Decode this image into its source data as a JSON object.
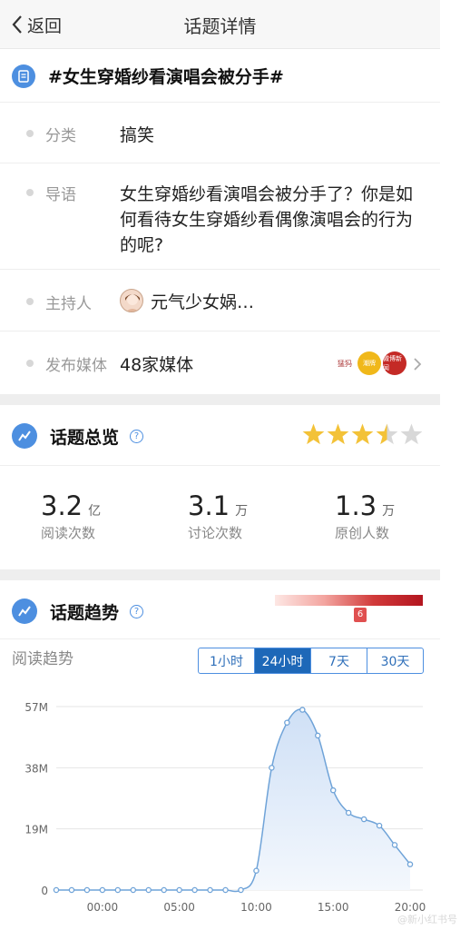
{
  "nav": {
    "back_label": "返回",
    "title": "话题详情"
  },
  "topic": {
    "title": "#女生穿婚纱看演唱会被分手#"
  },
  "info": {
    "category_label": "分类",
    "category_value": "搞笑",
    "intro_label": "导语",
    "intro_value": "女生穿婚纱看演唱会被分手了？你是如何看待女生穿婚纱看偶像演唱会的行为的呢?",
    "host_label": "主持人",
    "host_value": "元气少女娲…",
    "media_label": "发布媒体",
    "media_value": "48家媒体",
    "media_logos": [
      "猛犸",
      "潮牌",
      "微博新闻"
    ]
  },
  "overview": {
    "title": "话题总览",
    "rating": 3.5,
    "stats": [
      {
        "value": "3.2",
        "unit": "亿",
        "label": "阅读次数"
      },
      {
        "value": "3.1",
        "unit": "万",
        "label": "讨论次数"
      },
      {
        "value": "1.3",
        "unit": "万",
        "label": "原创人数"
      }
    ]
  },
  "trend": {
    "title": "话题趋势",
    "heat_level": "6",
    "sub_label": "阅读趋势",
    "tabs": [
      "1小时",
      "24小时",
      "7天",
      "30天"
    ],
    "active_tab": "24小时"
  },
  "chart_data": {
    "type": "area",
    "y_ticks": [
      "57M",
      "38M",
      "19M",
      "0"
    ],
    "x_ticks": [
      "00:00",
      "05:00",
      "10:00",
      "15:00",
      "20:00"
    ],
    "ylim": [
      0,
      57
    ],
    "y_unit": "M",
    "series": [
      {
        "values": [
          0,
          0,
          0,
          0,
          0,
          0,
          0,
          0,
          0,
          0,
          0,
          0,
          0,
          6,
          38,
          52,
          56,
          48,
          31,
          24,
          22,
          20,
          14,
          8
        ]
      }
    ],
    "hours": [
      -3,
      -2,
      -1,
      0,
      1,
      2,
      3,
      4,
      5,
      6,
      7,
      8,
      9,
      10,
      11,
      12,
      13,
      14,
      15,
      16,
      17,
      18,
      19,
      20
    ],
    "colors": {
      "line": "#6fa3d8",
      "fill": "#d9e8f8",
      "grid": "#e5e5e5"
    }
  },
  "watermark": "@新小红书号"
}
